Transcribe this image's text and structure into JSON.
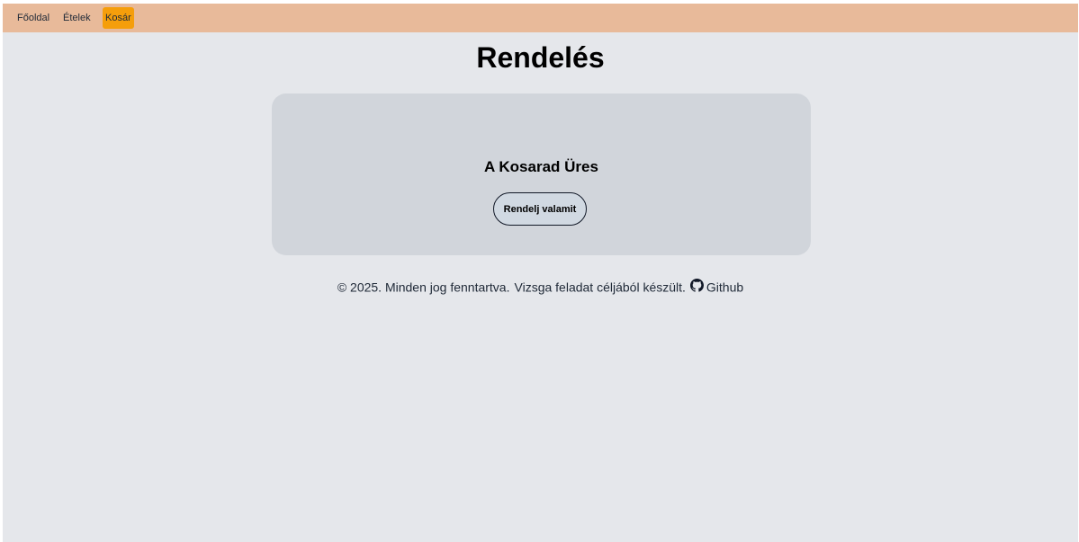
{
  "nav": {
    "items": [
      {
        "label": "Főoldal"
      },
      {
        "label": "Ételek"
      },
      {
        "label": "Kosár",
        "active": true
      }
    ],
    "active_color": "#f59e0b",
    "bar_color": "#e8ba9a"
  },
  "page": {
    "title": "Rendelés"
  },
  "cart": {
    "empty_message": "A Kosarad Üres",
    "order_button_label": "Rendelj valamit"
  },
  "footer": {
    "copyright": "© 2025. Minden jog fenntartva.",
    "note": "Vizsga feladat céljából készült.",
    "github_icon": "github-icon",
    "github_label": "Github"
  }
}
